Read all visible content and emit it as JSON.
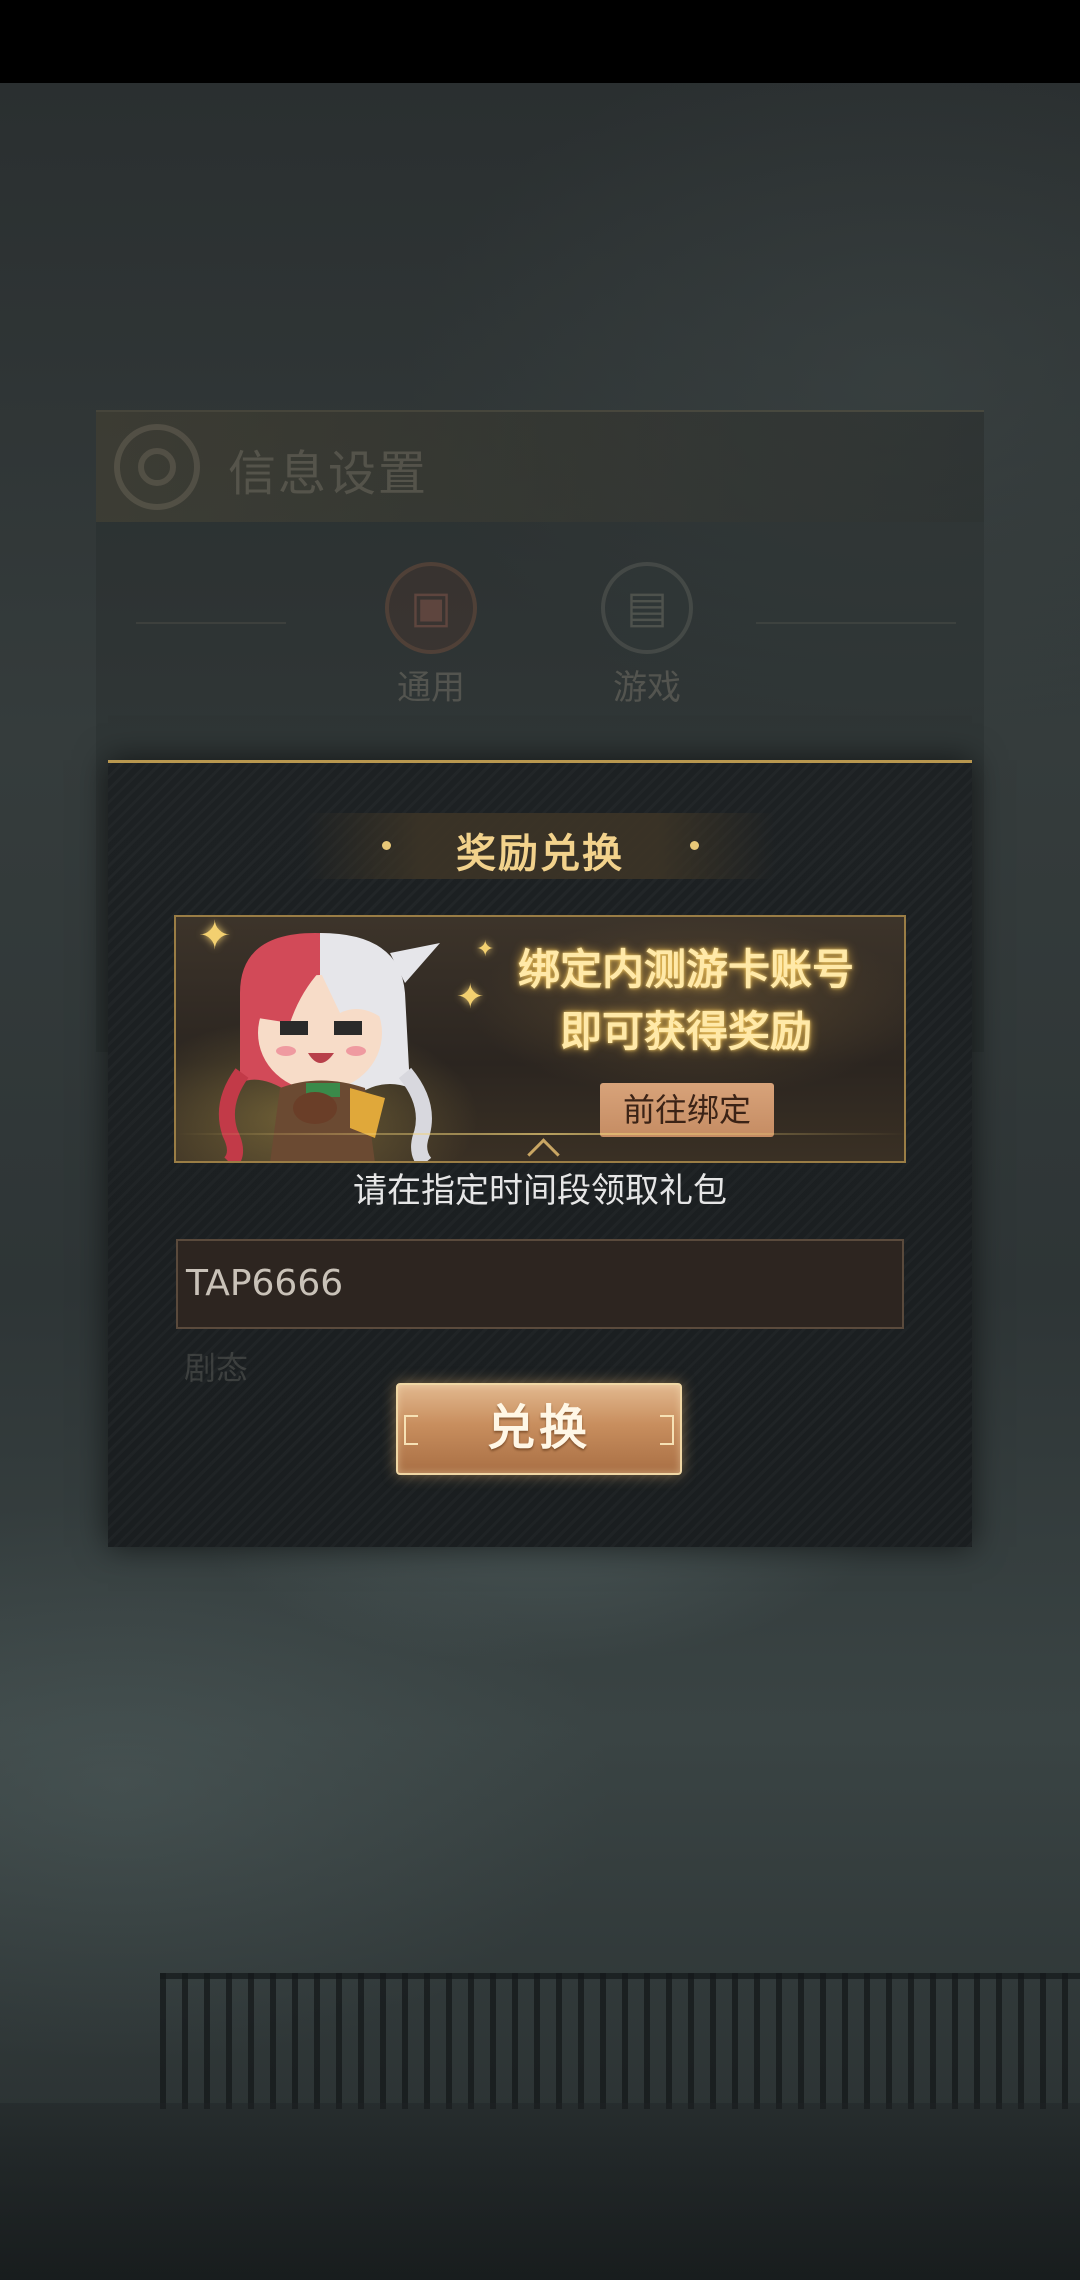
{
  "background_panel": {
    "title": "信息设置",
    "tabs": [
      {
        "label": "通用"
      },
      {
        "label": "游戏"
      }
    ],
    "ghost_label": "剧态"
  },
  "dialog": {
    "title": "奖励兑换",
    "banner": {
      "headline_line1": "绑定内测游卡账号",
      "headline_line2": "即可获得奖励",
      "bind_button": "前往绑定"
    },
    "hint": "请在指定时间段领取礼包",
    "code_input": {
      "value": "TAP6666"
    },
    "redeem_button": "兑换"
  },
  "colors": {
    "accent_gold": "#f2d28c",
    "button_copper": "#c88e5e",
    "modal_bg": "#1d2123"
  }
}
